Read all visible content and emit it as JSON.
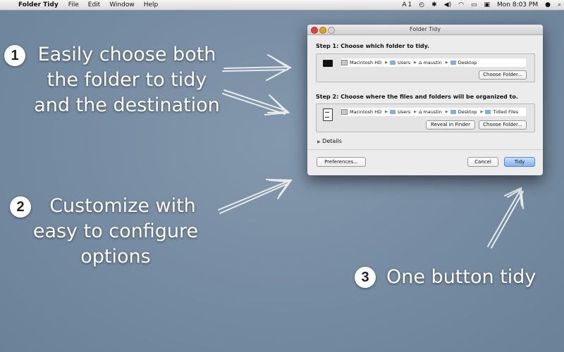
{
  "menubar": {
    "app_name": "Folder Tidy",
    "items": [
      "File",
      "Edit",
      "Window",
      "Help"
    ],
    "status": {
      "user_count": "1",
      "clock": "Mon 8:03 PM"
    }
  },
  "callouts": {
    "one": {
      "number": "1",
      "lines": [
        "Easily choose both",
        "the folder to tidy",
        "and the destination"
      ]
    },
    "two": {
      "number": "2",
      "lines": [
        "Customize with",
        "easy to configure",
        "options"
      ]
    },
    "three": {
      "number": "3",
      "text": "One button tidy"
    }
  },
  "window": {
    "title": "Folder Tidy",
    "step1": {
      "label": "Step 1: Choose which folder to tidy.",
      "path": [
        "Macintosh HD",
        "Users",
        "maustin",
        "Desktop"
      ],
      "choose_label": "Choose Folder..."
    },
    "step2": {
      "label": "Step 2: Choose where the files and folders will be organized to.",
      "path": [
        "Macintosh HD",
        "Users",
        "maustin",
        "Desktop",
        "Tidied Files"
      ],
      "reveal_label": "Reveal in Finder",
      "choose_label": "Choose Folder..."
    },
    "details_label": "Details",
    "preferences_label": "Preferences...",
    "cancel_label": "Cancel",
    "tidy_label": "Tidy"
  },
  "colors": {
    "background": "#7a8ea3",
    "tidy_button": "#7fb2f0",
    "close": "#e0443e",
    "minimize": "#dea123"
  }
}
